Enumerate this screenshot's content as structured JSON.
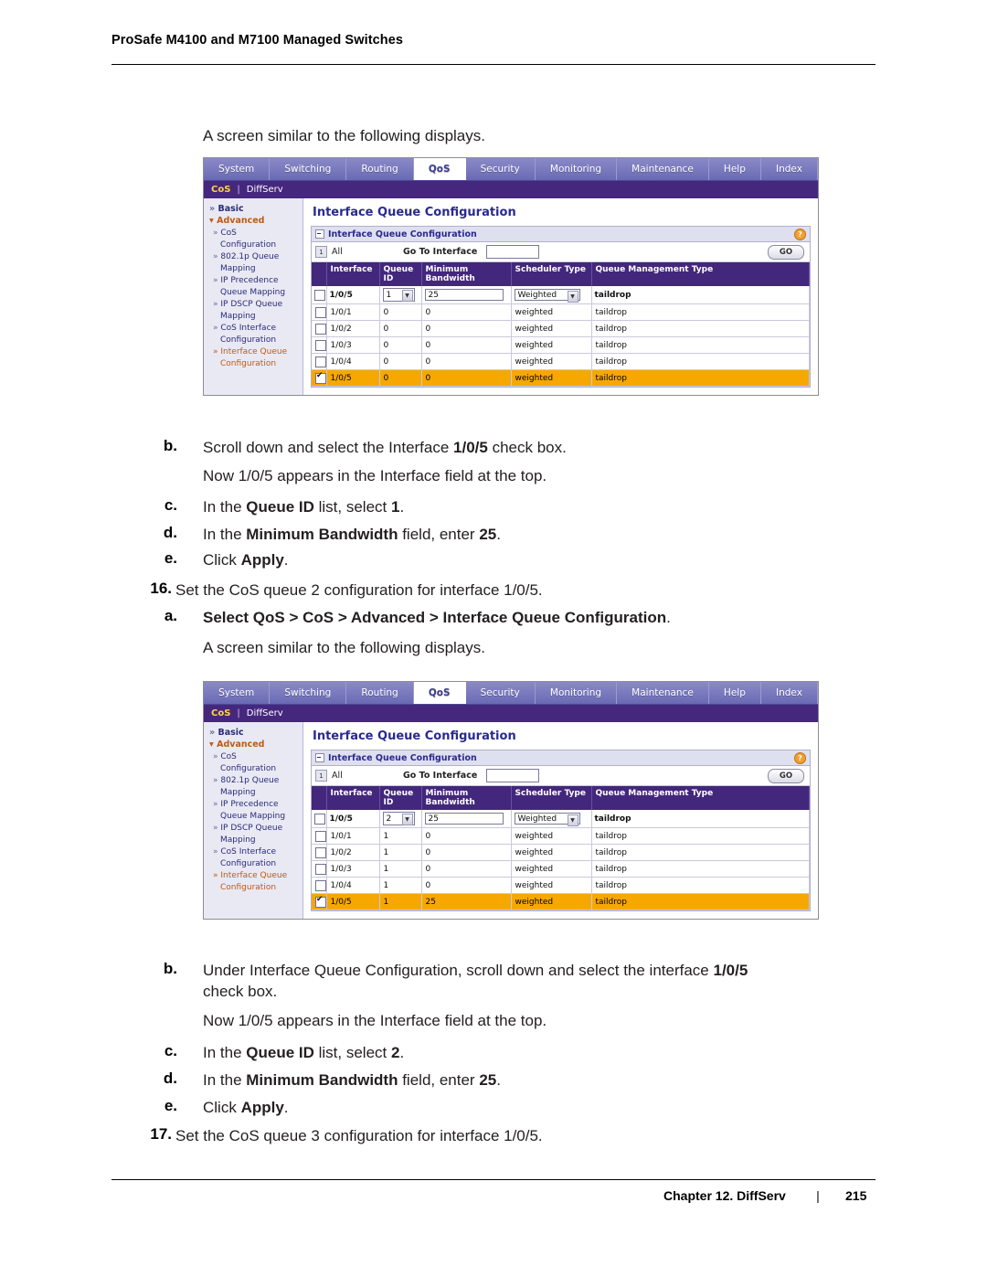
{
  "header": {
    "title": "ProSafe M4100 and M7100 Managed Switches"
  },
  "footer": {
    "chapter": "Chapter 12.  DiffServ",
    "bar": "|",
    "page": "215"
  },
  "body": {
    "line_screen_similar_1": "A screen similar to the following displays.",
    "step_b1_letter": "b.",
    "step_b1_text_pre": "Scroll down and select the Interface ",
    "step_b1_bold": "1/0/5",
    "step_b1_text_post": " check box.",
    "note1": "Now 1/0/5 appears in the Interface field at the top.",
    "step_c1_letter": "c.",
    "step_c1_pre": "In the ",
    "step_c1_bold1": "Queue ID",
    "step_c1_mid": " list, select ",
    "step_c1_bold2": "1",
    "step_c1_post": ".",
    "step_d1_letter": "d.",
    "step_d1_pre": "In the ",
    "step_d1_bold1": "Minimum Bandwidth",
    "step_d1_mid": " field, enter ",
    "step_d1_bold2": "25",
    "step_d1_post": ".",
    "step_e1_letter": "e.",
    "step_e1_pre": "Click ",
    "step_e1_bold": "Apply",
    "step_e1_post": ".",
    "step_16_num": "16.",
    "step_16_text": "Set the CoS queue 2 configuration for interface 1/0/5.",
    "step_a2_letter": "a.",
    "step_a2_text": "Select QoS > CoS > Advanced > Interface Queue Configuration",
    "step_a2_period": ".",
    "line_screen_similar_2": "A screen similar to the following displays.",
    "step_b2_letter": "b.",
    "step_b2_pre": "Under Interface Queue Configuration, scroll down and select the interface ",
    "step_b2_bold": "1/0/5",
    "step_b2_post2": "check box.",
    "note2": "Now 1/0/5 appears in the Interface field at the top.",
    "step_c2_letter": "c.",
    "step_c2_pre": "In the ",
    "step_c2_bold1": "Queue ID",
    "step_c2_mid": " list, select ",
    "step_c2_bold2": "2",
    "step_c2_post": ".",
    "step_d2_letter": "d.",
    "step_d2_pre": "In the ",
    "step_d2_bold1": "Minimum Bandwidth",
    "step_d2_mid": " field, enter ",
    "step_d2_bold2": "25",
    "step_d2_post": ".",
    "step_e2_letter": "e.",
    "step_e2_pre": "Click ",
    "step_e2_bold": "Apply",
    "step_e2_post": ".",
    "step_17_num": "17.",
    "step_17_text": "Set the CoS queue 3 configuration for interface 1/0/5."
  },
  "screenshot": {
    "menu": [
      {
        "label": "System",
        "active": false
      },
      {
        "label": "Switching",
        "active": false
      },
      {
        "label": "Routing",
        "active": false
      },
      {
        "label": "QoS",
        "active": true
      },
      {
        "label": "Security",
        "active": false
      },
      {
        "label": "Monitoring",
        "active": false
      },
      {
        "label": "Maintenance",
        "active": false
      },
      {
        "label": "Help",
        "active": false
      },
      {
        "label": "Index",
        "active": false
      }
    ],
    "submenu": {
      "first": "CoS",
      "separator": "|",
      "second": "DiffServ"
    },
    "sidebar": [
      {
        "label": "Basic",
        "type": "top",
        "arrow": "»"
      },
      {
        "label": "Advanced",
        "type": "top-selected",
        "arrow": "▾"
      },
      {
        "label": "CoS",
        "type": "item",
        "arrow": "»"
      },
      {
        "label": "Configuration",
        "type": "sub",
        "arrow": ""
      },
      {
        "label": "802.1p Queue",
        "type": "item",
        "arrow": "»"
      },
      {
        "label": "Mapping",
        "type": "sub",
        "arrow": ""
      },
      {
        "label": "IP Precedence",
        "type": "item",
        "arrow": "»"
      },
      {
        "label": "Queue Mapping",
        "type": "sub",
        "arrow": ""
      },
      {
        "label": "IP DSCP Queue",
        "type": "item",
        "arrow": "»"
      },
      {
        "label": "Mapping",
        "type": "sub",
        "arrow": ""
      },
      {
        "label": "CoS Interface",
        "type": "item",
        "arrow": "»"
      },
      {
        "label": "Configuration",
        "type": "sub",
        "arrow": ""
      },
      {
        "label": "Interface Queue",
        "type": "item-selected",
        "arrow": "»"
      },
      {
        "label": "Configuration",
        "type": "sub-selected",
        "arrow": ""
      }
    ],
    "page_title": "Interface Queue Configuration",
    "panel_title": "Interface Queue Configuration",
    "help_icon": "?",
    "go_row": {
      "index": "1",
      "all_label": "All",
      "go_to_label": "Go To Interface",
      "field_value": "",
      "go_button": "GO"
    },
    "columns": [
      "Interface",
      "Queue ID",
      "Minimum Bandwidth",
      "Scheduler Type",
      "Queue Management Type"
    ],
    "edit_row_1": {
      "interface": "1/0/5",
      "queue_id": "1",
      "min_bw": "25",
      "scheduler": "Weighted",
      "queue_mgmt": "taildrop"
    },
    "rows_1": [
      {
        "interface": "1/0/1",
        "queue_id": "0",
        "min_bw": "0",
        "scheduler": "weighted",
        "queue_mgmt": "taildrop",
        "selected": false
      },
      {
        "interface": "1/0/2",
        "queue_id": "0",
        "min_bw": "0",
        "scheduler": "weighted",
        "queue_mgmt": "taildrop",
        "selected": false
      },
      {
        "interface": "1/0/3",
        "queue_id": "0",
        "min_bw": "0",
        "scheduler": "weighted",
        "queue_mgmt": "taildrop",
        "selected": false
      },
      {
        "interface": "1/0/4",
        "queue_id": "0",
        "min_bw": "0",
        "scheduler": "weighted",
        "queue_mgmt": "taildrop",
        "selected": false
      },
      {
        "interface": "1/0/5",
        "queue_id": "0",
        "min_bw": "0",
        "scheduler": "weighted",
        "queue_mgmt": "taildrop",
        "selected": true
      }
    ],
    "edit_row_2": {
      "interface": "1/0/5",
      "queue_id": "2",
      "min_bw": "25",
      "scheduler": "Weighted",
      "queue_mgmt": "taildrop"
    },
    "rows_2": [
      {
        "interface": "1/0/1",
        "queue_id": "1",
        "min_bw": "0",
        "scheduler": "weighted",
        "queue_mgmt": "taildrop",
        "selected": false
      },
      {
        "interface": "1/0/2",
        "queue_id": "1",
        "min_bw": "0",
        "scheduler": "weighted",
        "queue_mgmt": "taildrop",
        "selected": false
      },
      {
        "interface": "1/0/3",
        "queue_id": "1",
        "min_bw": "0",
        "scheduler": "weighted",
        "queue_mgmt": "taildrop",
        "selected": false
      },
      {
        "interface": "1/0/4",
        "queue_id": "1",
        "min_bw": "0",
        "scheduler": "weighted",
        "queue_mgmt": "taildrop",
        "selected": false
      },
      {
        "interface": "1/0/5",
        "queue_id": "1",
        "min_bw": "25",
        "scheduler": "weighted",
        "queue_mgmt": "taildrop",
        "selected": true
      }
    ]
  }
}
